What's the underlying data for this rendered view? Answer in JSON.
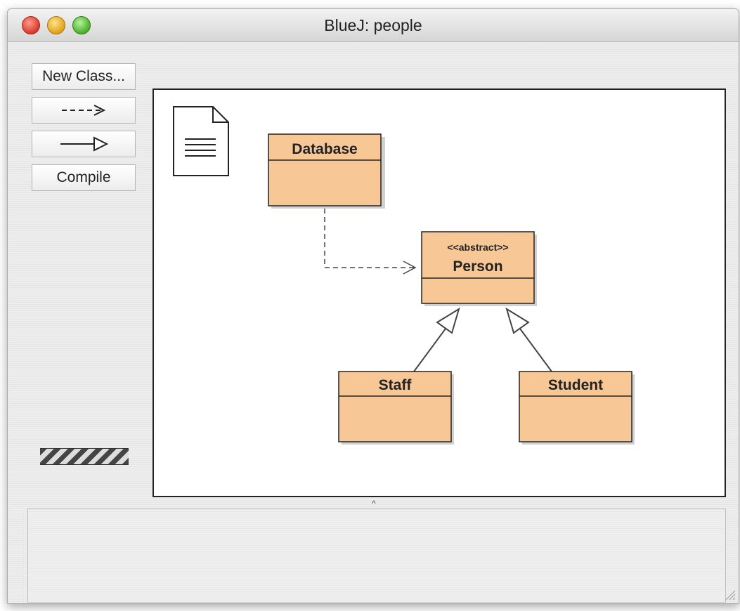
{
  "window": {
    "title": "BlueJ:  people"
  },
  "toolbar": {
    "new_class_label": "New Class...",
    "uses_arrow_icon": "dashed-arrow-icon",
    "inherit_arrow_icon": "inheritance-arrow-icon",
    "compile_label": "Compile"
  },
  "diagram": {
    "readme_icon": "document-icon",
    "classes": {
      "database": {
        "name": "Database"
      },
      "person": {
        "stereotype": "<<abstract>>",
        "name": "Person"
      },
      "staff": {
        "name": "Staff"
      },
      "student": {
        "name": "Student"
      }
    },
    "class_fill": "#f7c796",
    "relationships": [
      {
        "from": "Database",
        "to": "Person",
        "type": "uses"
      },
      {
        "from": "Staff",
        "to": "Person",
        "type": "inherits"
      },
      {
        "from": "Student",
        "to": "Person",
        "type": "inherits"
      }
    ]
  },
  "terminal": {
    "text": ""
  }
}
